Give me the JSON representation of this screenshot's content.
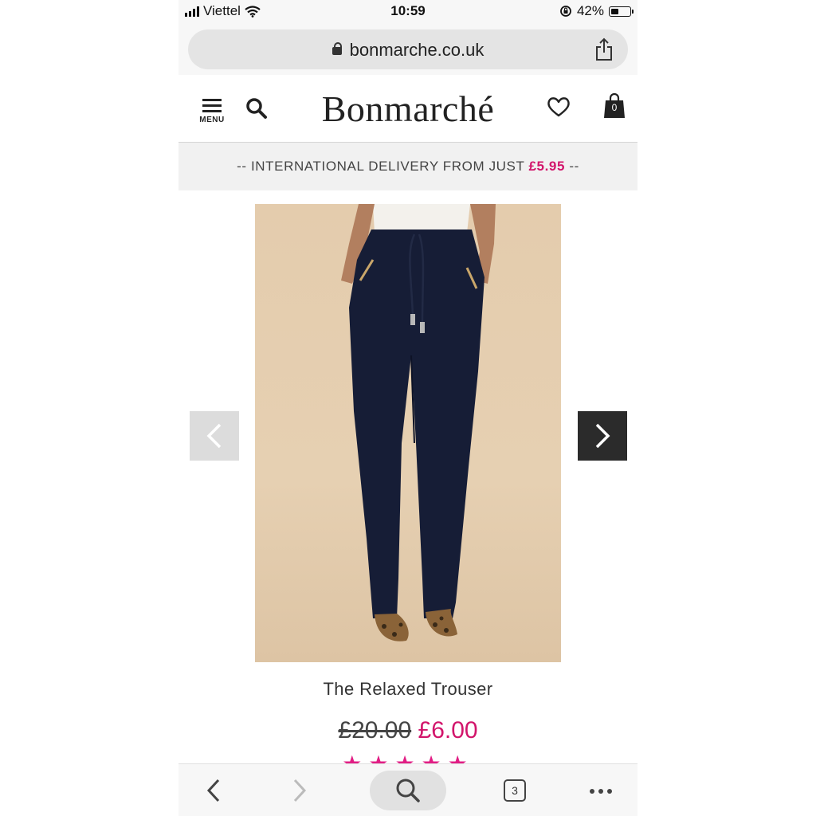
{
  "status_bar": {
    "carrier": "Viettel",
    "time": "10:59",
    "battery": "42%",
    "battery_level": 0.42
  },
  "browser": {
    "url": "bonmarche.co.uk",
    "tabs_count": "3"
  },
  "header": {
    "menu_label": "MENU",
    "logo_text": "Bonmarché",
    "bag_count": "0"
  },
  "banner": {
    "text": "-- INTERNATIONAL DELIVERY FROM JUST ",
    "price": "£5.95",
    "suffix": " --"
  },
  "product": {
    "title": "The Relaxed Trouser",
    "old_price": "£20.00",
    "new_price": "£6.00",
    "rating_stars": "★★★★★",
    "rating": 5
  },
  "colors": {
    "accent": "#d2156b",
    "stars": "#e11d84",
    "next_arrow_bg": "#2b2b2b",
    "prev_arrow_bg": "#dcdcdc"
  }
}
